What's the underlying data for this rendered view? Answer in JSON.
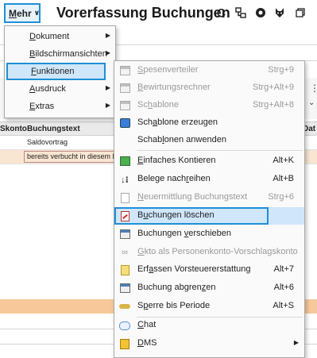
{
  "toolbar": {
    "mehr_mnemonic": "M",
    "mehr_rest": "ehr",
    "chevron": "∨",
    "title": "Vorerfassung Buchungen",
    "icons": [
      "refresh-icon",
      "org-chart-icon",
      "help-icon",
      "rabbit-icon",
      "window-icon"
    ]
  },
  "grid": {
    "headers": {
      "skonto": "Skonto",
      "buchungstext": "Buchungstext",
      "dat": "Dat"
    },
    "rows": [
      {
        "text": "Saldovortrag"
      },
      {
        "text": "bereits verbucht in diesem M"
      }
    ]
  },
  "main_menu": {
    "items": [
      {
        "mnemonic": "D",
        "rest": "okument",
        "submenu": true
      },
      {
        "mnemonic": "B",
        "rest": "ildschirmansichten",
        "submenu": true
      },
      {
        "mnemonic": "F",
        "rest": "unktionen",
        "submenu": true,
        "active": true
      },
      {
        "mnemonic": "A",
        "rest": "usdruck",
        "submenu": true
      },
      {
        "mnemonic": "E",
        "rest": "xtras",
        "submenu": true
      }
    ]
  },
  "sub_menu": {
    "items": [
      {
        "pre": "",
        "mnemonic": "S",
        "post": "pesenverteiler",
        "shortcut": "Strg+9",
        "disabled": true,
        "icon": "table-icon"
      },
      {
        "pre": "",
        "mnemonic": "B",
        "post": "ewirtungsrechner",
        "shortcut": "Strg+Alt+9",
        "disabled": true,
        "icon": "table-icon"
      },
      {
        "pre": "Sc",
        "mnemonic": "h",
        "post": "ablone",
        "shortcut": "Strg+Alt+8",
        "disabled": true,
        "icon": "table-icon"
      },
      {
        "pre": "Sch",
        "mnemonic": "a",
        "post": "blone erzeugen",
        "shortcut": "",
        "disabled": false,
        "icon": "template-create-icon"
      },
      {
        "pre": "Schab",
        "mnemonic": "l",
        "post": "onen anwenden",
        "shortcut": "",
        "disabled": false,
        "icon": ""
      },
      {
        "pre": "",
        "mnemonic": "E",
        "post": "infaches Kontieren",
        "shortcut": "Alt+K",
        "disabled": false,
        "icon": "green-arrow-icon"
      },
      {
        "pre": "Belege nach",
        "mnemonic": "r",
        "post": "eihen",
        "shortcut": "Alt+B",
        "disabled": false,
        "icon": "sort-icon"
      },
      {
        "pre": "",
        "mnemonic": "N",
        "post": "euermittlung Buchungstext",
        "shortcut": "Strg+6",
        "disabled": true,
        "icon": "document-icon"
      },
      {
        "pre": "B",
        "mnemonic": "u",
        "post": "chungen löschen",
        "shortcut": "",
        "disabled": false,
        "active": true,
        "icon": "delete-document-icon"
      },
      {
        "pre": "Buchungen ",
        "mnemonic": "v",
        "post": "erschieben",
        "shortcut": "",
        "disabled": false,
        "icon": "table-icon"
      },
      {
        "pre": "",
        "mnemonic": "G",
        "post": "kto als Personenkonto-Vorschlagskonto",
        "shortcut": "",
        "disabled": true,
        "icon": "binoculars-icon"
      },
      {
        "pre": "Erf",
        "mnemonic": "a",
        "post": "ssen Vorsteuererstattung",
        "shortcut": "Alt+7",
        "disabled": false,
        "icon": "tax-refund-icon"
      },
      {
        "pre": "Buchung abgren",
        "mnemonic": "z",
        "post": "en",
        "shortcut": "Alt+6",
        "disabled": false,
        "icon": "table-icon"
      },
      {
        "pre": "S",
        "mnemonic": "p",
        "post": "erre bis Periode",
        "shortcut": "Alt+S",
        "disabled": false,
        "icon": "key-icon"
      },
      {
        "pre": "",
        "mnemonic": "C",
        "post": "hat",
        "shortcut": "",
        "disabled": false,
        "icon": "chat-icon"
      },
      {
        "pre": "",
        "mnemonic": "D",
        "post": "MS",
        "shortcut": "",
        "disabled": false,
        "submenu": true,
        "icon": "dms-icon"
      }
    ]
  },
  "colors": {
    "accent_border": "#1f8fd6",
    "highlight_bg": "#cfe6fb",
    "orange_band": "#f7c99a",
    "selected_row": "#f9e6d2"
  }
}
